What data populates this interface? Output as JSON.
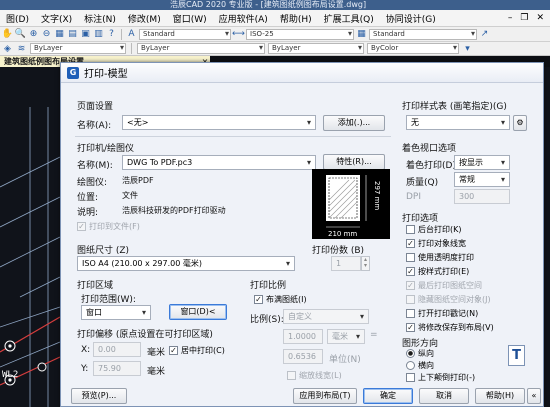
{
  "app": {
    "title": "浩辰CAD 2020 专业版 - [建筑图纸例图布局设置.dwg]",
    "menu": [
      "图(D)",
      "文字(X)",
      "标注(N)",
      "修改(M)",
      "窗口(W)",
      "应用软件(A)",
      "帮助(H)",
      "扩展工具(Q)",
      "协同设计(G)"
    ],
    "toolbar_combos": {
      "text_style": "Standard",
      "dim_style": "ISO-25",
      "table_style": "Standard"
    },
    "layer_combos": {
      "layer": "ByLayer",
      "linetype": "ByLayer",
      "lineweight": "ByLayer",
      "color": "ByColor"
    },
    "doc_tab": "建筑图纸例图布局设置",
    "canvas_label": "WL2"
  },
  "dialog": {
    "title": "打印-模型",
    "page_setup": {
      "section": "页面设置",
      "name_label": "名称(A):",
      "name_value": "<无>",
      "add_button": "添加(.)..."
    },
    "printer": {
      "section": "打印机/绘图仪",
      "name_label": "名称(M):",
      "name_value": "DWG To PDF.pc3",
      "properties_button": "特性(R)...",
      "plotter_label": "绘图仪:",
      "plotter_value": "浩辰PDF",
      "location_label": "位置:",
      "location_value": "文件",
      "desc_label": "说明:",
      "desc_value": "浩辰科技研发的PDF打印驱动",
      "print_to_file": "打印到文件(F)"
    },
    "preview": {
      "width_dim": "210 mm",
      "height_dim": "297 mm"
    },
    "paper": {
      "section": "图纸尺寸 (Z)",
      "value": "ISO A4 (210.00 x 297.00 毫米)"
    },
    "copies": {
      "label": "打印份数 (B)",
      "value": "1"
    },
    "area": {
      "section": "打印区域",
      "range_label": "打印范围(W):",
      "range_value": "窗口",
      "window_button": "窗口(D)<"
    },
    "offset": {
      "section": "打印偏移 (原点设置在可打印区域)",
      "x_label": "X:",
      "x_value": "0.00",
      "x_unit": "毫米",
      "y_label": "Y:",
      "y_value": "75.90",
      "y_unit": "毫米",
      "center": "居中打印(C)"
    },
    "scale": {
      "section": "打印比例",
      "fit": "布满图纸(I)",
      "ratio_label": "比例(S):",
      "ratio_value": "自定义",
      "value1": "1.0000",
      "unit_value": "毫米",
      "equals": "=",
      "value2": "0.6536",
      "unit_label": "单位(N)",
      "scale_lw": "缩放线宽(L)"
    },
    "style_table": {
      "section": "打印样式表 (画笔指定)(G)",
      "value": "无"
    },
    "shaded": {
      "section": "着色视口选项",
      "shade_label": "着色打印(D)",
      "shade_value": "按显示",
      "quality_label": "质量(Q)",
      "quality_value": "常规",
      "dpi_label": "DPI",
      "dpi_value": "300"
    },
    "options": {
      "section": "打印选项",
      "items": [
        {
          "label": "后台打印(K)",
          "checked": false,
          "disabled": false
        },
        {
          "label": "打印对象线宽",
          "checked": true,
          "disabled": false
        },
        {
          "label": "使用透明度打印",
          "checked": false,
          "disabled": false
        },
        {
          "label": "按样式打印(E)",
          "checked": true,
          "disabled": false
        },
        {
          "label": "最后打印图纸空间",
          "checked": true,
          "disabled": true
        },
        {
          "label": "隐藏图纸空间对象(J)",
          "checked": false,
          "disabled": true
        },
        {
          "label": "打开打印戳记(N)",
          "checked": false,
          "disabled": false
        },
        {
          "label": "将修改保存到布局(V)",
          "checked": true,
          "disabled": false
        }
      ]
    },
    "orientation": {
      "section": "图形方向",
      "portrait": "纵向",
      "landscape": "横向",
      "upside_down": "上下颠倒打印(-)"
    },
    "footer": {
      "preview": "预览(P)...",
      "apply": "应用到布局(T)",
      "ok": "确定",
      "cancel": "取消",
      "help": "帮助(H)"
    }
  }
}
